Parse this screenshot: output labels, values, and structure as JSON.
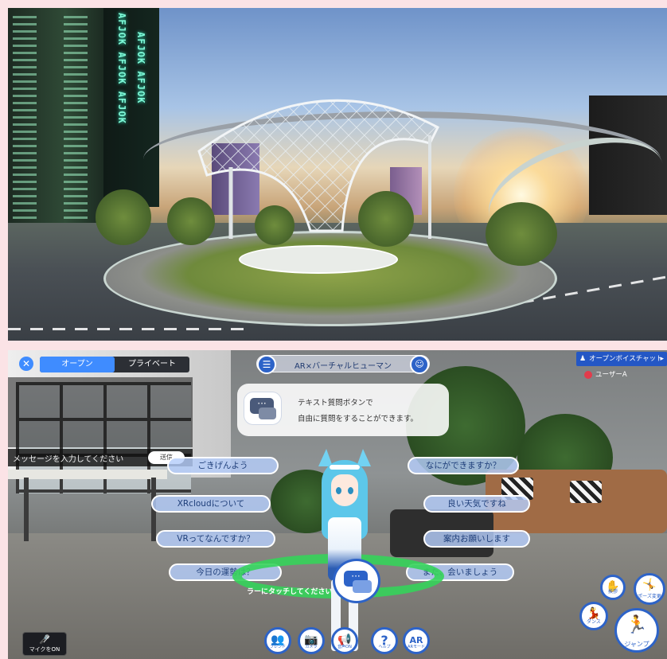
{
  "top_scene": {
    "neon_signs": [
      "AFJOK AFJOK AFJOK",
      "AFJOK AFJOK"
    ]
  },
  "chat_panel": {
    "tabs": [
      {
        "label": "オープン",
        "active": true
      },
      {
        "label": "プライベート",
        "active": false
      }
    ],
    "message_placeholder": "メッセージを入力してください",
    "send_label": "送信"
  },
  "header": {
    "title": "AR×バーチャルヒューマン"
  },
  "open_chat": {
    "label": "オープンボイスチャット",
    "user": "ユーザーA"
  },
  "hint": {
    "line1": "テキスト質問ボタンで",
    "line2": "自由に質問をすることができます。"
  },
  "choices_left": [
    "ごきげんよう",
    "XRcloudについて",
    "VRってなんですか？",
    "今日の運勢は？"
  ],
  "choices_right": [
    "なにができますか？",
    "良い天気ですね",
    "案内お願いします",
    "また、会いましょう"
  ],
  "ring_text": "ラーにタッチしてください。",
  "mic": {
    "label": "マイクをON"
  },
  "toolbar": [
    {
      "icon": "people-icon",
      "glyph": "👥",
      "label": "フレンド"
    },
    {
      "icon": "camera-icon",
      "glyph": "📷",
      "label": "カメラ"
    },
    {
      "icon": "megaphone-icon",
      "glyph": "📢",
      "label": "音声ON"
    },
    {
      "icon": "help-icon",
      "glyph": "?",
      "label": "ヘルプ"
    },
    {
      "icon": "ar-icon",
      "glyph": "AR",
      "label": "ARモード"
    }
  ],
  "side_buttons": {
    "wave": "挨拶",
    "pose": "ポーズ変更",
    "dance": "ダンス",
    "jump": "ジャンプ"
  },
  "colors": {
    "accent": "#2d63c8",
    "ring": "#35d35a",
    "chip": "#b4cdfa"
  }
}
